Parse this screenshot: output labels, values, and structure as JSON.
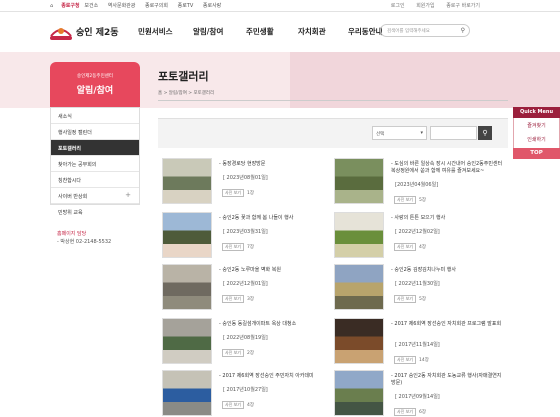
{
  "top_links": [
    "종로구청",
    "보건소",
    "역사문화관광",
    "종로구의회",
    "종로TV",
    "종로사랑"
  ],
  "top_right": [
    "로그인",
    "회원가입",
    "종로구 바로가기"
  ],
  "logo_text": "숭인 제2동",
  "gnb": [
    "민원서비스",
    "알림/참여",
    "주민생활",
    "자치회관",
    "우리동안내"
  ],
  "search": {
    "placeholder": "검색어를 입력해주세요",
    "icon": "search-icon"
  },
  "side": {
    "subtitle": "숭인제2동주민센터",
    "title": "알림/참여",
    "items": [
      {
        "label": "새소식"
      },
      {
        "label": "행사일정 캘린더"
      },
      {
        "label": "포토갤러리"
      },
      {
        "label": "찾아가는 공무회의"
      },
      {
        "label": "칭찬합시다"
      },
      {
        "label": "사이버 반상회"
      },
      {
        "label": "민방위 교육"
      }
    ],
    "contact_label": "홈페이지 담당",
    "contact": "- 박상현 02-2148-5532"
  },
  "page_title": "포토갤러리",
  "breadcrumb": [
    "홈",
    "알림/참여",
    "포토갤러리"
  ],
  "filter": {
    "select": "선택"
  },
  "gallery": [
    {
      "title": "- 동장경로당 현장방문",
      "date": "[ 2023년08월01일]",
      "views": "1장",
      "badge": "사진 보기"
    },
    {
      "title": "- 도심의 바른 일상속 장시 시간내어 숭인2동주민센터 복상정원에서 쏟과 함께 여유를 즐겨보세요~",
      "date": "[2023년04월06일]",
      "views": "5장",
      "badge": "사진 보기"
    },
    {
      "title": "- 숭인2동 꽃과 함께 봄 나들이 행사",
      "date": "[ 2023년03월31일]",
      "views": "7장",
      "badge": "사진 보기"
    },
    {
      "title": "- 사랑의 튼튼 모으기 행사",
      "date": "[ 2022년12월02일]",
      "views": "4장",
      "badge": "사진 보기"
    },
    {
      "title": "- 숭인2동 노루마을 벽화 복원",
      "date": "[ 2022년12월01일]",
      "views": "3장",
      "badge": "사진 보기"
    },
    {
      "title": "- 숭인2동 김장김치나누미 행사",
      "date": "[ 2022년11월30일]",
      "views": "5장",
      "badge": "사진 보기"
    },
    {
      "title": "- 숭인동 동길섬개이파트 옥상 대청소",
      "date": "[ 2022년08월19일]",
      "views": "2장",
      "badge": "사진 보기"
    },
    {
      "title": "- 2017 제6회역 장선숭인 자치회관 프로그램 발표회",
      "date": "[ 2017년11월14일]",
      "views": "14장",
      "badge": "사진 보기"
    },
    {
      "title": "- 2017 제6회역 장선숭인 주민자치 아카데미",
      "date": "[ 2017년10월27일]",
      "views": "4장",
      "badge": "사진 보기"
    },
    {
      "title": "- 2017 숭인2동 자치회관 도농교류 행사(자매결연지 방문)",
      "date": "[ 2017년09월14일]",
      "views": "6장",
      "badge": "사진 보기"
    }
  ],
  "quick": {
    "head": "Quick Menu",
    "items": [
      "즐겨찾기",
      "인쇄하기"
    ],
    "top": "TOP"
  }
}
